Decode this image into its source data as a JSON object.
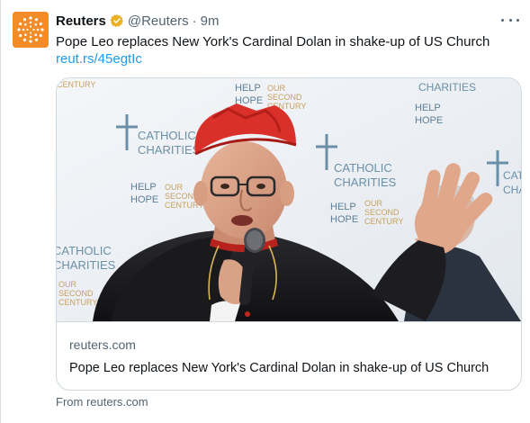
{
  "tweet": {
    "author_name": "Reuters",
    "handle": "@Reuters",
    "separator": "·",
    "time": "9m",
    "text": "Pope Leo replaces New York's Cardinal Dolan in shake-up of US Church",
    "link": "reut.rs/45egtIc",
    "verified_color": "#e8b022"
  },
  "card": {
    "domain": "reuters.com",
    "title": "Pope Leo replaces New York's Cardinal Dolan in shake-up of US Church",
    "backdrop_logo": {
      "line1": "CATHOLIC",
      "line2": "CHARITIES",
      "tagline1": "HELP",
      "tagline2": "HOPE",
      "side1": "OUR",
      "side2": "SECOND",
      "side3": "CENTURY"
    }
  },
  "source_text": "From reuters.com",
  "colors": {
    "brand_orange": "#f28c28",
    "link_blue": "#1d9bf0",
    "cardinal_red": "#d9302a"
  },
  "icons": {
    "avatar": "reuters-logo-icon",
    "verified": "verified-badge-icon",
    "more": "more-options-icon"
  }
}
